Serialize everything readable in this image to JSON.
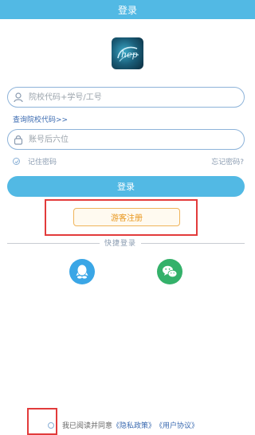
{
  "header": {
    "title": "登录"
  },
  "login_form": {
    "username_placeholder": "院校代码+学号/工号",
    "query_school_code_link": "查询院校代码>>",
    "password_placeholder": "账号后六位",
    "remember_password_label": "记住密码",
    "forgot_password_link": "忘记密码?",
    "login_button": "登录"
  },
  "guest": {
    "register_button": "游客注册"
  },
  "quick_login": {
    "label": "快捷登录",
    "options": [
      {
        "icon": "qq-icon",
        "color": "#3aa6e6"
      },
      {
        "icon": "wechat-icon",
        "color": "#34b16a"
      }
    ]
  },
  "agreement": {
    "prefix": "我已阅读并同意",
    "privacy_policy": "《隐私政策》",
    "user_agreement": "《用户协议》"
  },
  "colors": {
    "primary": "#52b9e4",
    "guest_border": "#f0b45a",
    "guest_text": "#e8961c",
    "highlight": "#e23b3b",
    "link": "#3a6ab0"
  }
}
